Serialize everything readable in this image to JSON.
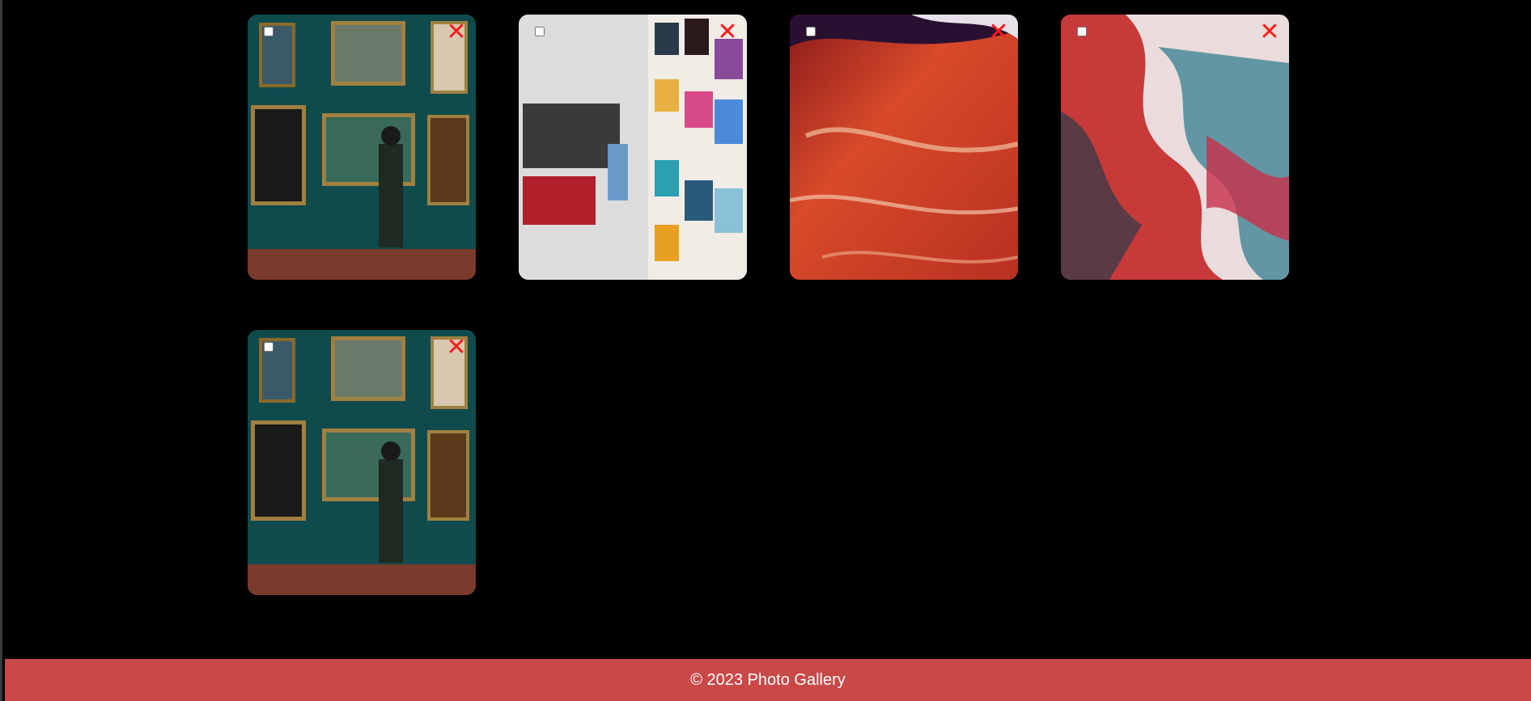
{
  "gallery": {
    "cards": [
      {
        "remove_icon": "close-icon",
        "checked": false
      },
      {
        "remove_icon": "close-icon",
        "checked": false
      },
      {
        "remove_icon": "close-icon",
        "checked": false
      },
      {
        "remove_icon": "close-icon",
        "checked": false
      },
      {
        "remove_icon": "close-icon",
        "checked": false
      }
    ],
    "remove_glyph": "✕"
  },
  "footer": {
    "text": "© 2023 Photo Gallery"
  },
  "colors": {
    "background": "#000000",
    "footer": "#c94848",
    "remove": "#ff1a1a"
  }
}
